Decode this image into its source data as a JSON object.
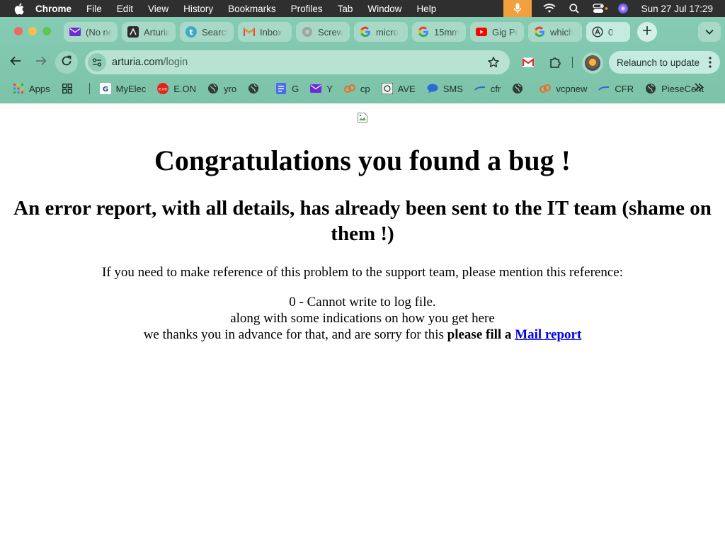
{
  "menubar": {
    "app_name": "Chrome",
    "items": [
      "File",
      "Edit",
      "View",
      "History",
      "Bookmarks",
      "Profiles",
      "Tab",
      "Window",
      "Help"
    ],
    "clock": "Sun 27 Jul  17:29"
  },
  "tabs": [
    {
      "title": "(No ne",
      "icon": "mail-icon"
    },
    {
      "title": "Arturia",
      "icon": "arturia-icon"
    },
    {
      "title": "Search",
      "icon": "t-icon"
    },
    {
      "title": "Inbox",
      "icon": "gmail-icon"
    },
    {
      "title": "Screw",
      "icon": "globe-icon"
    },
    {
      "title": "micro",
      "icon": "google-icon"
    },
    {
      "title": "15mm",
      "icon": "google-icon"
    },
    {
      "title": "Gig Pe",
      "icon": "youtube-icon"
    },
    {
      "title": "which",
      "icon": "google-icon"
    }
  ],
  "active_tab": {
    "title": "0",
    "icon": "arturia-logo-icon"
  },
  "omnibox": {
    "domain": "arturia.com",
    "path": "/login"
  },
  "relaunch_label": "Relaunch to update",
  "bookmarks": [
    {
      "label": "Apps",
      "icon": "apps-grid-icon"
    },
    {
      "label": "",
      "icon": "grid-icon"
    },
    {
      "label": "MyElec",
      "icon": "myelec-icon"
    },
    {
      "label": "E.ON",
      "icon": "eon-icon"
    },
    {
      "label": "yro",
      "icon": "globe-icon"
    },
    {
      "label": "",
      "icon": "globe-icon"
    },
    {
      "label": "G",
      "icon": "doc-icon"
    },
    {
      "label": "Y",
      "icon": "mail-icon"
    },
    {
      "label": "cp",
      "icon": "cp-icon"
    },
    {
      "label": "AVE",
      "icon": "ave-icon"
    },
    {
      "label": "SMS",
      "icon": "sms-icon"
    },
    {
      "label": "cfr",
      "icon": "cfr-icon"
    },
    {
      "label": "",
      "icon": "globe-icon"
    },
    {
      "label": "vcpnew",
      "icon": "cp-icon"
    },
    {
      "label": "CFR",
      "icon": "cfr-icon"
    },
    {
      "label": "PieseCent",
      "icon": "globe-icon"
    }
  ],
  "page": {
    "heading": "Congratulations you found a bug !",
    "subheading": "An error report, with all details, has already been sent to the IT team (shame on them !)",
    "reference_intro": "If you need to make reference of this problem to the support team, please mention this reference:",
    "reference": "0 - Cannot write to log file.",
    "indications": "along with some indications on how you get here",
    "thanks": "we thanks you in advance for that, and are sorry for this ",
    "fill_label": "please fill a ",
    "mail_link": "Mail report"
  }
}
